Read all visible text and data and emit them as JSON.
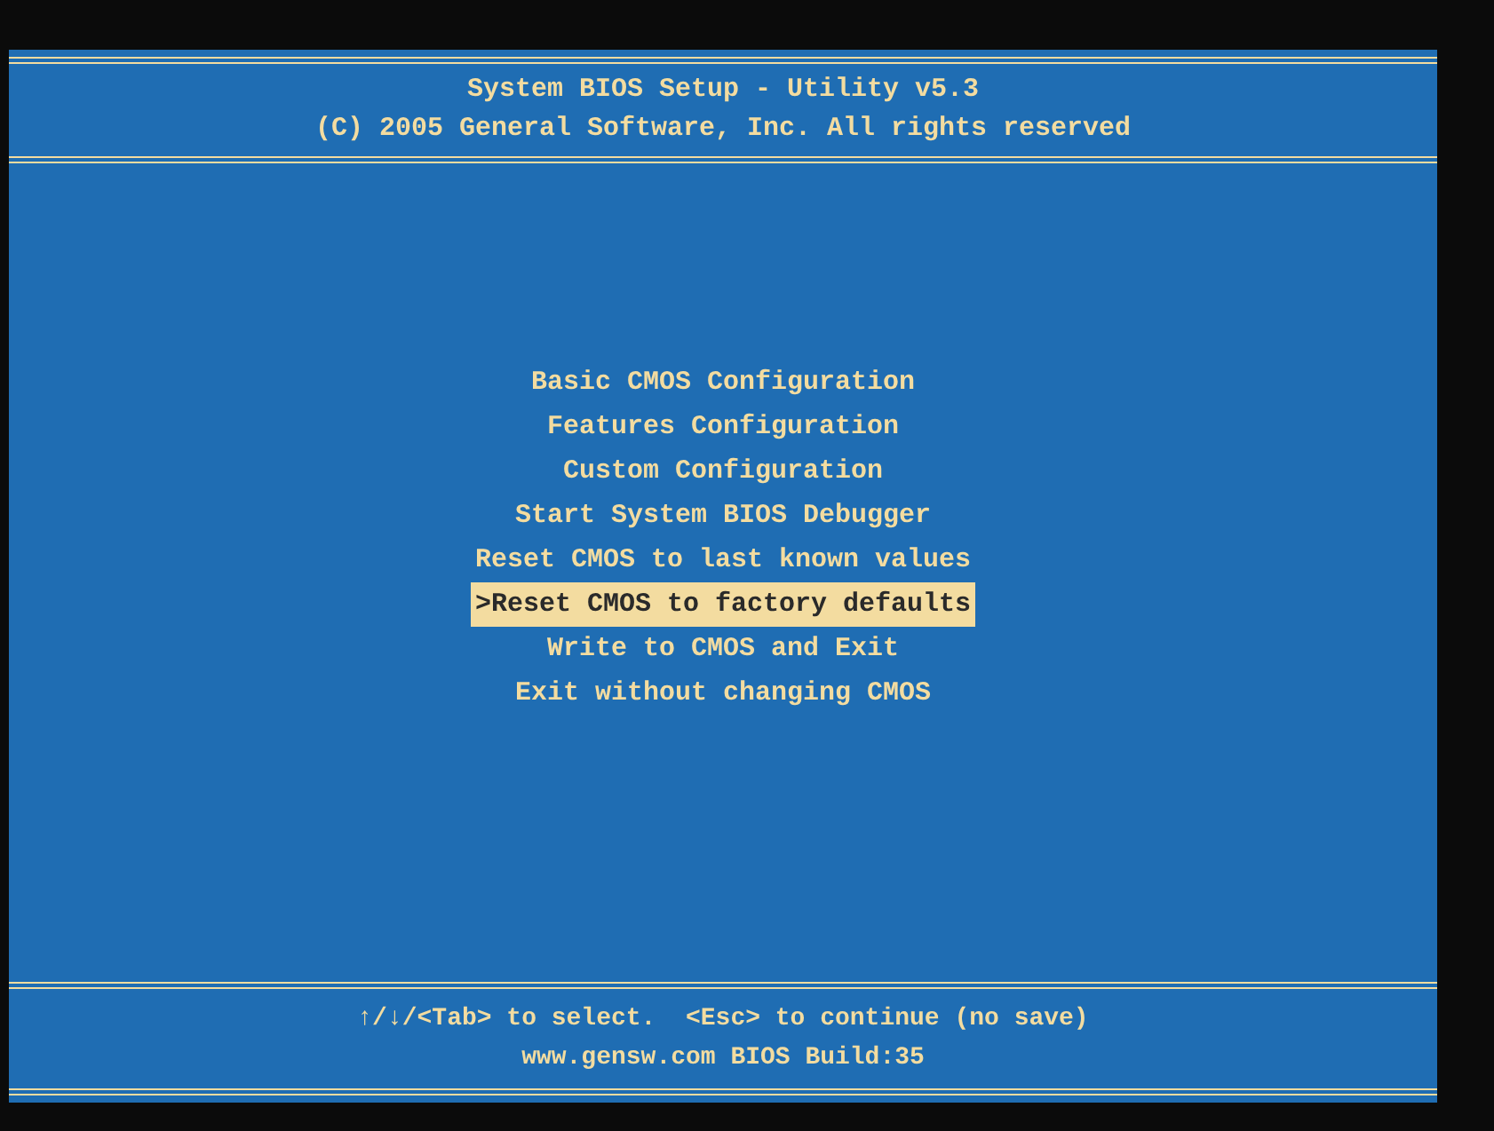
{
  "header": {
    "title": "System BIOS Setup - Utility v5.3",
    "copyright": "(C) 2005 General Software, Inc. All rights reserved"
  },
  "menu": [
    {
      "label": "Basic CMOS Configuration",
      "selected": false
    },
    {
      "label": "Features Configuration",
      "selected": false
    },
    {
      "label": "Custom Configuration",
      "selected": false
    },
    {
      "label": "Start System BIOS Debugger",
      "selected": false
    },
    {
      "label": "Reset CMOS to last known values",
      "selected": false
    },
    {
      "label": ">Reset CMOS to factory defaults",
      "selected": true
    },
    {
      "label": "Write to CMOS and Exit",
      "selected": false
    },
    {
      "label": "Exit without changing CMOS",
      "selected": false
    }
  ],
  "footer": {
    "hint": "↑/↓/<Tab> to select.  <Esc> to continue (no save)",
    "build": "www.gensw.com BIOS Build:35"
  }
}
